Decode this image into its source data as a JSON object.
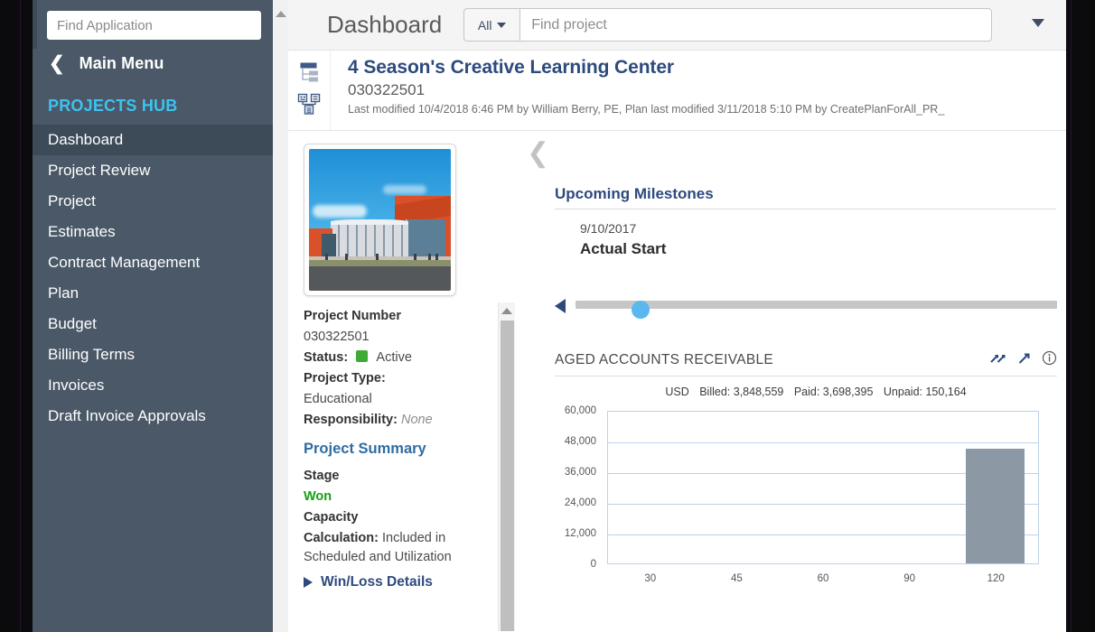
{
  "sidebar": {
    "search_placeholder": "Find Application",
    "back_label": "Main Menu",
    "hub_title": "PROJECTS HUB",
    "items": [
      {
        "label": "Dashboard",
        "active": true
      },
      {
        "label": "Project Review",
        "active": false
      },
      {
        "label": "Project",
        "active": false
      },
      {
        "label": "Estimates",
        "active": false
      },
      {
        "label": "Contract Management",
        "active": false
      },
      {
        "label": "Plan",
        "active": false
      },
      {
        "label": "Budget",
        "active": false
      },
      {
        "label": "Billing Terms",
        "active": false
      },
      {
        "label": "Invoices",
        "active": false
      },
      {
        "label": "Draft Invoice Approvals",
        "active": false
      }
    ]
  },
  "topbar": {
    "title": "Dashboard",
    "scope_value": "All",
    "search_placeholder": "Find project"
  },
  "project": {
    "name": "4 Season's Creative Learning Center",
    "number_header": "030322501",
    "modified": "Last modified 10/4/2018 6:46 PM by William Berry, PE, Plan last modified 3/11/2018 5:10 PM by CreatePlanForAll_PR_"
  },
  "details": {
    "project_number_label": "Project Number",
    "project_number_value": "030322501",
    "status_label": "Status:",
    "status_value": "Active",
    "status_color": "#3faa35",
    "project_type_label": "Project Type:",
    "project_type_value": "Educational",
    "responsibility_label": "Responsibility:",
    "responsibility_value": "None",
    "summary_link": "Project Summary",
    "stage_label": "Stage",
    "stage_value": "Won",
    "stage_color": "#14a014",
    "capacity_label": "Capacity",
    "calculation_label": "Calculation:",
    "calculation_value": "Included in Scheduled and Utilization",
    "winloss_label": "Win/Loss Details"
  },
  "milestones": {
    "section_title": "Upcoming Milestones",
    "date": "9/10/2017",
    "name": "Actual Start"
  },
  "chart_data": {
    "type": "bar",
    "title": "AGED ACCOUNTS RECEIVABLE",
    "currency": "USD",
    "billed_label": "Billed: 3,848,559",
    "paid_label": "Paid: 3,698,395",
    "unpaid_label": "Unpaid: 150,164",
    "categories": [
      "30",
      "45",
      "60",
      "90",
      "120"
    ],
    "values": [
      0,
      0,
      0,
      0,
      45000
    ],
    "xlabel": "",
    "ylabel": "",
    "ylim": [
      0,
      60000
    ],
    "yticks": [
      0,
      12000,
      24000,
      36000,
      48000,
      60000
    ],
    "yticklabels": [
      "0",
      "12,000",
      "24,000",
      "36,000",
      "48,000",
      "60,000"
    ],
    "grid": true,
    "legend": "none",
    "bar_color": "#8c98a4"
  }
}
